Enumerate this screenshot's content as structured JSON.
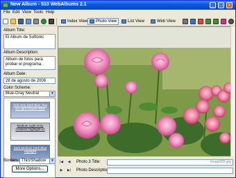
{
  "window": {
    "title": "New Album - 510 WebAlbums 2.1",
    "controls": {
      "minimize": "_",
      "maximize": "□",
      "close": "x"
    }
  },
  "menu": [
    "File",
    "Edit",
    "View",
    "Tools",
    "Help"
  ],
  "toolbar": {
    "index_view": "Index View",
    "photo_view": "Photo View",
    "list_view": "List View",
    "web_view": "Web View"
  },
  "album": {
    "title_label": "Album Title:",
    "title_value": "El Album de Softonic",
    "description_label": "Album Description:",
    "description_value": "Album de fotos para probar el programa.",
    "date_label": "Album Date:",
    "date_value": "28 de agosto de 2006",
    "scheme_label": "Color Scheme:",
    "scheme_value": "Blue-Gray Neutral",
    "schemes": [
      "Soft Very Dark Blue Text on Light Grayish Blue",
      "Medium Light Gray Gradient Highlight on",
      "Dark Medium Dark Blue Highlight"
    ],
    "borders_label": "Borders:",
    "borders_value": "Thin/Shadow",
    "more_options": "More Options..."
  },
  "photo": {
    "title_label": "Photo 3 Title:",
    "description_label": "Photo Description:",
    "filename": "image005.jpg"
  },
  "icons": {
    "new": "new-icon",
    "open": "open-icon",
    "save": "save-icon",
    "prev": "prev-icon",
    "next": "next-icon"
  }
}
